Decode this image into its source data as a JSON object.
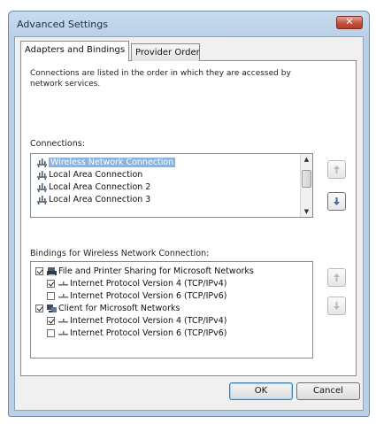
{
  "window": {
    "title": "Advanced Settings",
    "close_glyph": "✕"
  },
  "tabs": [
    {
      "label": "Adapters and Bindings",
      "active": true
    },
    {
      "label": "Provider Order",
      "active": false
    }
  ],
  "description": "Connections are listed in the order in which they are accessed by network services.",
  "connections": {
    "label": "Connections:",
    "items": [
      {
        "label": "Wireless Network Connection",
        "selected": true
      },
      {
        "label": "Local Area Connection",
        "selected": false
      },
      {
        "label": "Local Area Connection 2",
        "selected": false
      },
      {
        "label": "Local Area Connection 3",
        "selected": false
      }
    ]
  },
  "bindings": {
    "label": "Bindings for Wireless Network Connection:",
    "items": [
      {
        "label": "File and Printer Sharing for Microsoft Networks",
        "checked": true,
        "level": 0,
        "icon": "printer-share-icon"
      },
      {
        "label": "Internet Protocol Version 4 (TCP/IPv4)",
        "checked": true,
        "level": 1,
        "icon": "protocol-icon"
      },
      {
        "label": "Internet Protocol Version 6 (TCP/IPv6)",
        "checked": false,
        "level": 1,
        "icon": "protocol-icon"
      },
      {
        "label": "Client for Microsoft Networks",
        "checked": true,
        "level": 0,
        "icon": "network-client-icon"
      },
      {
        "label": "Internet Protocol Version 4 (TCP/IPv4)",
        "checked": true,
        "level": 1,
        "icon": "protocol-icon"
      },
      {
        "label": "Internet Protocol Version 6 (TCP/IPv6)",
        "checked": false,
        "level": 1,
        "icon": "protocol-icon"
      }
    ]
  },
  "buttons": {
    "ok": "OK",
    "cancel": "Cancel"
  },
  "colors": {
    "selection": "#8eb4dd",
    "frame": "#b8cfe6",
    "close": "#c2513d"
  }
}
